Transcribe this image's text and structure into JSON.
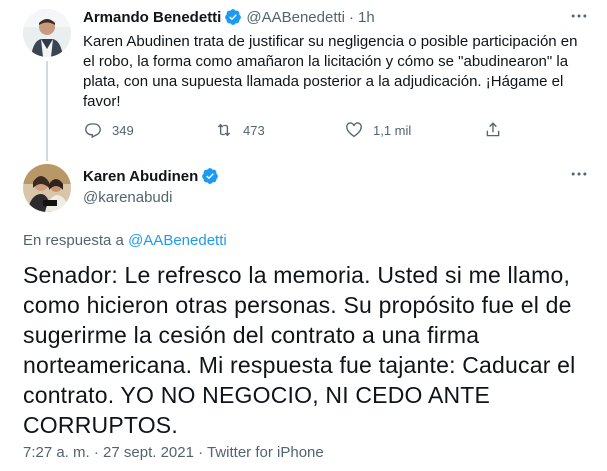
{
  "parent_tweet": {
    "author_name": "Armando Benedetti",
    "author_handle": "@AABenedetti",
    "separator": "·",
    "time": "1h",
    "text": "Karen Abudinen trata de justificar su negligencia o posible participación en el robo, la forma como amañaron la licitación y cómo se \"abudinearon\" la plata, con una supuesta llamada posterior a la adjudicación. ¡Hágame el favor!",
    "actions": {
      "replies": "349",
      "retweets": "473",
      "likes": "1,1 mil"
    },
    "more_icon": "ellipsis-icon"
  },
  "main_tweet": {
    "author_name": "Karen Abudinen",
    "author_handle": "@karenabudi",
    "reply_prefix": "En respuesta a ",
    "reply_to": "@AABenedetti",
    "text": "Senador: Le refresco la memoria. Usted si me llamo, como hicieron otras personas. Su propósito fue el de sugerirme la cesión del contrato a una firma norteamericana. Mi respuesta fue tajante: Caducar el contrato. YO NO NEGOCIO, NI CEDO ANTE CORRUPTOS.",
    "timestamp": "7:27 a. m. · 27 sept. 2021 · Twitter for iPhone"
  },
  "colors": {
    "verified_blue": "#1d9bf0",
    "text_primary": "#0f1419",
    "text_secondary": "#536471",
    "thread_line": "#cfd9de"
  }
}
